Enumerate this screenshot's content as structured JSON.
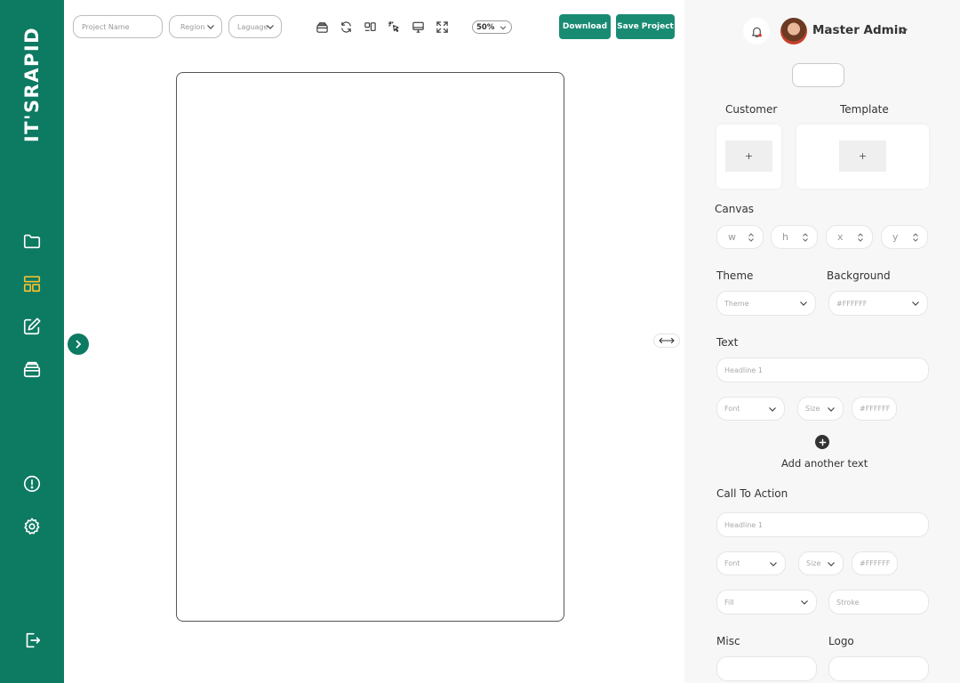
{
  "brand": {
    "logo_text": "IT'SRAPID"
  },
  "sidebar": {
    "items": [
      {
        "name": "folder-icon",
        "active": false
      },
      {
        "name": "layout-icon",
        "active": true
      },
      {
        "name": "edit-icon",
        "active": false
      },
      {
        "name": "layers-icon",
        "active": false
      },
      {
        "name": "info-icon",
        "active": false
      },
      {
        "name": "settings-icon",
        "active": false
      },
      {
        "name": "logout-icon",
        "active": false
      }
    ],
    "active_color": "#f2c230"
  },
  "toolbar": {
    "project_name_placeholder": "Project Name",
    "region_label": "Region",
    "language_label": "Laguage",
    "zoom_label": "50%",
    "download_label": "Download",
    "save_label": "Save Project",
    "tools": [
      "layers-icon",
      "refresh-icon",
      "align-icon",
      "pointer-icon",
      "monitor-icon",
      "fullscreen-icon"
    ]
  },
  "user": {
    "name": "Master Admin"
  },
  "panel": {
    "customer_label": "Customer",
    "template_label": "Template",
    "upload_symbol": "+",
    "canvas_label": "Canvas",
    "canvas_fields": [
      "w",
      "h",
      "x",
      "y"
    ],
    "theme_label": "Theme",
    "theme_placeholder": "Theme",
    "background_label": "Background",
    "background_value": "#FFFFFF",
    "text_label": "Text",
    "text_headline_placeholder": "Headline 1",
    "font_placeholder": "Font",
    "size_placeholder": "Size",
    "color_placeholder": "#FFFFFF",
    "add_text_label": "Add another text",
    "cta_label": "Call To Action",
    "cta_headline_placeholder": "Headline 1",
    "fill_placeholder": "Fill",
    "stroke_placeholder": "Stroke",
    "misc_label": "Misc",
    "logo_label": "Logo"
  },
  "colors": {
    "brand": "#0d7a62",
    "button": "#1a8b73",
    "panel_bg": "#f7f7f7"
  }
}
